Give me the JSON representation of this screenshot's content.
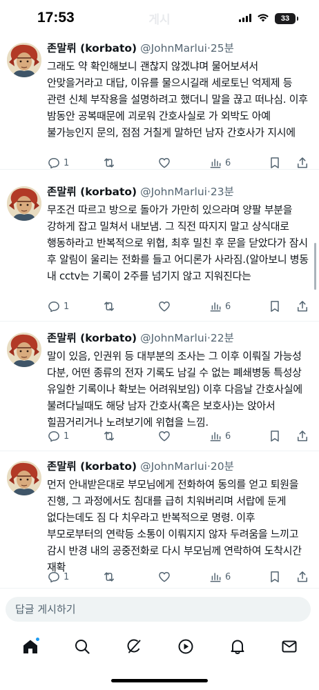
{
  "status_bar": {
    "time": "17:53",
    "battery": "33"
  },
  "header": {
    "faded_title": "게시"
  },
  "tweets": [
    {
      "name": "존말뤼 (korbato)",
      "handle": "@JohnMarlui",
      "time": "25분",
      "text": "그래도 약 확인해보니 괜찮지 않겠냐며 물어보셔서 안맞을거라고 대답, 이유를 물으시길래 세로토닌 억제제 등 관련 신체 부작용을 설명하려고 했더니 말을 끊고 떠나심. 이후 밤동안 공복때문에 괴로워 간호사실로 가 외박도 아예 불가능인지 문의, 점점 거칠게 말하던 남자 간호사가 지시에",
      "replies": "1",
      "views": "6"
    },
    {
      "name": "존말뤼 (korbato)",
      "handle": "@JohnMarlui",
      "time": "23분",
      "text": "무조건 따르고 방으로 돌아가 가만히 있으라며 양팔 부분을 강하게 잡고 밀쳐서 내보냄. 그 직전 따지지 말고 상식대로 행동하라고 반복적으로 위협, 최후 밀친 후 문을 닫았다가 잠시 후 알림이 울리는 전화를 들고 어디론가 사라짐.(알아보니 병동 내 cctv는 기록이 2주를 넘기지 않고 지워진다는",
      "replies": "1",
      "views": "6"
    },
    {
      "name": "존말뤼 (korbato)",
      "handle": "@JohnMarlui",
      "time": "22분",
      "text": "말이 있음, 인권위 등 대부분의 조사는 그 이후 이뤄질 가능성 다분, 어떤 종류의 전자 기록도 남길 수 없는 폐쇄병동 특성상 유일한 기록이나 확보는 어려워보임) 이후 다음날 간호사실에 불려다닐때도 해당 남자 간호사(혹은 보호사)는 앉아서 힐끔거리거나 노려보기에 위협을 느낌.",
      "replies": "1",
      "views": "6"
    },
    {
      "name": "존말뤼 (korbato)",
      "handle": "@JohnMarlui",
      "time": "20분",
      "text": "먼저 안내받은대로 부모님에게 전화하여 동의를 얻고 퇴원을 진행, 그 과정에서도 침대를 급히 치워버리며 서랍에 둔게 없다는데도 짐 다 치우라고 반복적으로 명령. 이후 부모로부터의 연락등 소통이 이뤄지지 않자 두려움을 느끼고 감시 반경 내의 공중전화로 다시 부모님께 연락하여 도착시간 재확",
      "replies": "1",
      "views": "6"
    }
  ],
  "reply_bar": {
    "placeholder": "답글 게시하기"
  },
  "tab_bar": {
    "tabs": [
      "home-icon",
      "search-icon",
      "grok-icon",
      "play-icon",
      "bell-icon",
      "mail-icon"
    ],
    "accent": "#1d9bf0"
  },
  "colors": {
    "text": "#0f1419",
    "secondary": "#536471",
    "divider": "#eff3f4"
  }
}
